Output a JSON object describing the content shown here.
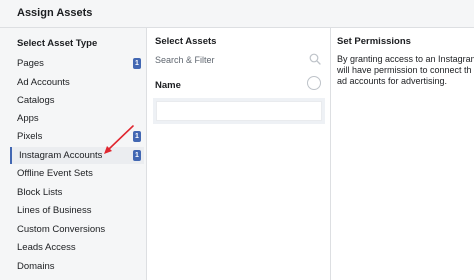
{
  "header": {
    "title": "Assign Assets"
  },
  "asset_type": {
    "heading": "Select Asset Type",
    "items": [
      {
        "label": "Pages",
        "badge": "1"
      },
      {
        "label": "Ad Accounts"
      },
      {
        "label": "Catalogs"
      },
      {
        "label": "Apps"
      },
      {
        "label": "Pixels",
        "badge": "1"
      },
      {
        "label": "Instagram Accounts",
        "badge": "1",
        "selected": true
      },
      {
        "label": "Offline Event Sets"
      },
      {
        "label": "Block Lists"
      },
      {
        "label": "Lines of Business"
      },
      {
        "label": "Custom Conversions"
      },
      {
        "label": "Leads Access"
      },
      {
        "label": "Domains"
      }
    ]
  },
  "assets": {
    "heading": "Select Assets",
    "search_placeholder": "Search & Filter",
    "name_header": "Name"
  },
  "permissions": {
    "heading": "Set Permissions",
    "text": "By granting access to an Instagram\nwill have permission to connect th\nad accounts for advertising."
  },
  "colors": {
    "accent": "#4267b2",
    "annotation_arrow": "#e0262f"
  },
  "icons": {
    "search": "search-icon",
    "select_all": "radio-circle-icon",
    "annotation": "arrow-annotation"
  }
}
